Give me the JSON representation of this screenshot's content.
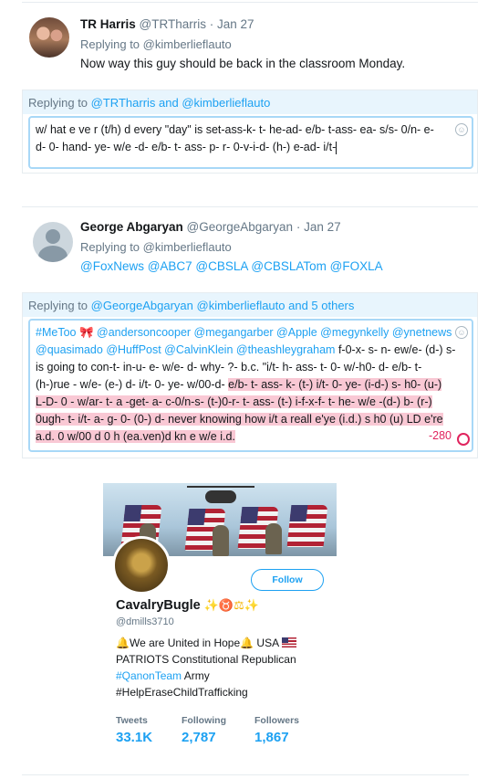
{
  "tweet1": {
    "name": "TR Harris",
    "handle": "@TRTharris",
    "time": "· Jan 27",
    "replying_label": "Replying to",
    "replying_to": "@kimberlieflauto",
    "text": "Now way this guy should be back in the classroom Monday."
  },
  "composer1": {
    "replying_label": "Replying to",
    "replying_to": "@TRTharris and @kimberlieflauto",
    "line1": "w/ hat e ve r (t/h) d   every \"day\" is  set-ass-k- t- he-ad- e/b- t-ass- ea- s/s- 0/n- e-",
    "line2": "d- 0- hand- ye- w/e -d- e/b- t- ass- p- r- 0-v-i-d- (h-) e-ad- i/t-"
  },
  "tweet2": {
    "name": "George Abgaryan",
    "handle": "@GeorgeAbgaryan",
    "time": "· Jan 27",
    "replying_label": "Replying to",
    "replying_to": "@kimberlieflauto",
    "text": "@FoxNews @ABC7 @CBSLA @CBSLATom @FOXLA"
  },
  "composer2": {
    "replying_label": "Replying to",
    "replying_to": "@GeorgeAbgaryan @kimberlieflauto and 5 others",
    "l1_tag": "#MeToo",
    "l1_rest": "@andersoncooper  @megangarber @Apple @megynkelly @ynetnews",
    "l2": "@quasimado @HuffPost @CalvinKlein @theashleygraham",
    "l2_plain": " f-0-x- s- n- ew/e- (d-) s-",
    "l3": "is going to con-t- in-u- e- w/e- d-    why- ?-  b.c. \"i/t- h- ass- t- 0- w/-h0- d- e/b- t-",
    "l4": "(h-)rue - w/e- (e-) d- i/t- 0- ye- w/00-d- ",
    "l4_hl": "e/b- t- ass- k- (t-) i/t- 0- ye- (i-d-) s- h0- (u-)",
    "l5_hl": "L-D-  0 - w/ar- t- a -get- a- c-0/n-s- (t-)0-r- t- ass- (t-) i-f-x-f- t- he- w/e -(d-) b- (r-)",
    "l6_hl": "0ugh- t- i/t- a- g- 0- (0-) d-",
    "l6_rest": "  never knowing how i/t a reall e'ye (i.d.) s h0 (u) LD e're",
    "l7_hl": "a.d. 0 w/00 d 0 h (ea.ven)d kn e w/e i.d.",
    "counter": "-280"
  },
  "profile": {
    "name": "CavalryBugle",
    "name_emoji": "✨♉⚖✨",
    "handle": "@dmills3710",
    "follow_label": "Follow",
    "bio1": "We are United in Hope",
    "bio1b": " USA ",
    "bio2": "PATRIOTS Constitutional Republican",
    "bio3_tag": "#QanonTeam",
    "bio3_rest": " Army",
    "bio4": "#HelpEraseChildTrafficking",
    "stats": [
      {
        "label": "Tweets",
        "value": "33.1K"
      },
      {
        "label": "Following",
        "value": "2,787"
      },
      {
        "label": "Followers",
        "value": "1,867"
      }
    ]
  },
  "colors": {
    "link": "#1da1f2",
    "highlight": "#f9c8d4",
    "counter": "#e0245e"
  }
}
